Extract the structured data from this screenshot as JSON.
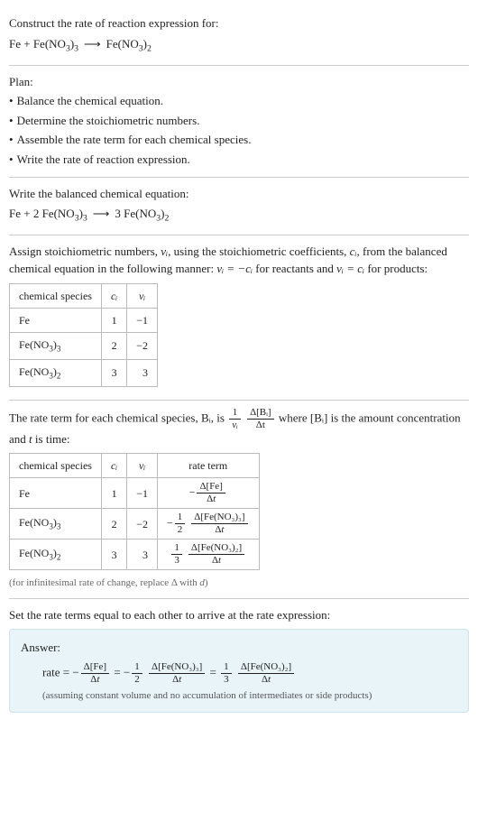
{
  "title": "Construct the rate of reaction expression for:",
  "equation_unbalanced": "Fe + Fe(NO₃)₃ ⟶ Fe(NO₃)₂",
  "plan": {
    "heading": "Plan:",
    "items": [
      "Balance the chemical equation.",
      "Determine the stoichiometric numbers.",
      "Assemble the rate term for each chemical species.",
      "Write the rate of reaction expression."
    ]
  },
  "balanced": {
    "heading": "Write the balanced chemical equation:",
    "equation": "Fe + 2 Fe(NO₃)₃ ⟶ 3 Fe(NO₃)₂"
  },
  "stoich": {
    "intro_before": "Assign stoichiometric numbers, ",
    "nu_i": "νᵢ",
    "intro_mid1": ", using the stoichiometric coefficients, ",
    "c_i": "cᵢ",
    "intro_mid2": ", from the balanced chemical equation in the following manner: ",
    "rel1": "νᵢ = −cᵢ",
    "intro_mid3": " for reactants and ",
    "rel2": "νᵢ = cᵢ",
    "intro_after": " for products:",
    "headers": {
      "species": "chemical species",
      "ci": "cᵢ",
      "nui": "νᵢ"
    },
    "rows": [
      {
        "species": "Fe",
        "ci": "1",
        "nui": "−1"
      },
      {
        "species": "Fe(NO₃)₃",
        "ci": "2",
        "nui": "−2"
      },
      {
        "species": "Fe(NO₃)₂",
        "ci": "3",
        "nui": "3"
      }
    ]
  },
  "rateterm": {
    "intro_before": "The rate term for each chemical species, ",
    "Bi": "Bᵢ",
    "intro_mid1": ", is ",
    "frac1_num": "1",
    "frac1_den": "νᵢ",
    "frac2_num": "Δ[Bᵢ]",
    "frac2_den": "Δt",
    "intro_mid2": " where [Bᵢ] is the amount concentration and ",
    "t": "t",
    "intro_after": " is time:",
    "headers": {
      "species": "chemical species",
      "ci": "cᵢ",
      "nui": "νᵢ",
      "rate": "rate term"
    },
    "rows": [
      {
        "species": "Fe",
        "ci": "1",
        "nui": "−1",
        "sign": "−",
        "coef_num": "",
        "coef_den": "",
        "bracket": "Δ[Fe]"
      },
      {
        "species": "Fe(NO₃)₃",
        "ci": "2",
        "nui": "−2",
        "sign": "−",
        "coef_num": "1",
        "coef_den": "2",
        "bracket": "Δ[Fe(NO₃)₃]"
      },
      {
        "species": "Fe(NO₃)₂",
        "ci": "3",
        "nui": "3",
        "sign": "",
        "coef_num": "1",
        "coef_den": "3",
        "bracket": "Δ[Fe(NO₃)₂]"
      }
    ],
    "footnote": "(for infinitesimal rate of change, replace Δ with d)"
  },
  "final": {
    "heading": "Set the rate terms equal to each other to arrive at the rate expression:",
    "answer_label": "Answer:",
    "rate_label": "rate = ",
    "t1_sign": "−",
    "t1_num": "Δ[Fe]",
    "t1_den": "Δt",
    "eq": " = ",
    "t2_sign": "−",
    "t2_cnum": "1",
    "t2_cden": "2",
    "t2_num": "Δ[Fe(NO₃)₃]",
    "t2_den": "Δt",
    "t3_cnum": "1",
    "t3_cden": "3",
    "t3_num": "Δ[Fe(NO₃)₂]",
    "t3_den": "Δt",
    "assumption": "(assuming constant volume and no accumulation of intermediates or side products)"
  },
  "chart_data": {
    "type": "table",
    "tables": [
      {
        "title": "stoichiometric numbers",
        "columns": [
          "chemical species",
          "cᵢ",
          "νᵢ"
        ],
        "rows": [
          [
            "Fe",
            1,
            -1
          ],
          [
            "Fe(NO₃)₃",
            2,
            -2
          ],
          [
            "Fe(NO₃)₂",
            3,
            3
          ]
        ]
      },
      {
        "title": "rate terms",
        "columns": [
          "chemical species",
          "cᵢ",
          "νᵢ",
          "rate term"
        ],
        "rows": [
          [
            "Fe",
            1,
            -1,
            "−Δ[Fe]/Δt"
          ],
          [
            "Fe(NO₃)₃",
            2,
            -2,
            "−(1/2) Δ[Fe(NO₃)₃]/Δt"
          ],
          [
            "Fe(NO₃)₂",
            3,
            3,
            "(1/3) Δ[Fe(NO₃)₂]/Δt"
          ]
        ]
      }
    ]
  }
}
